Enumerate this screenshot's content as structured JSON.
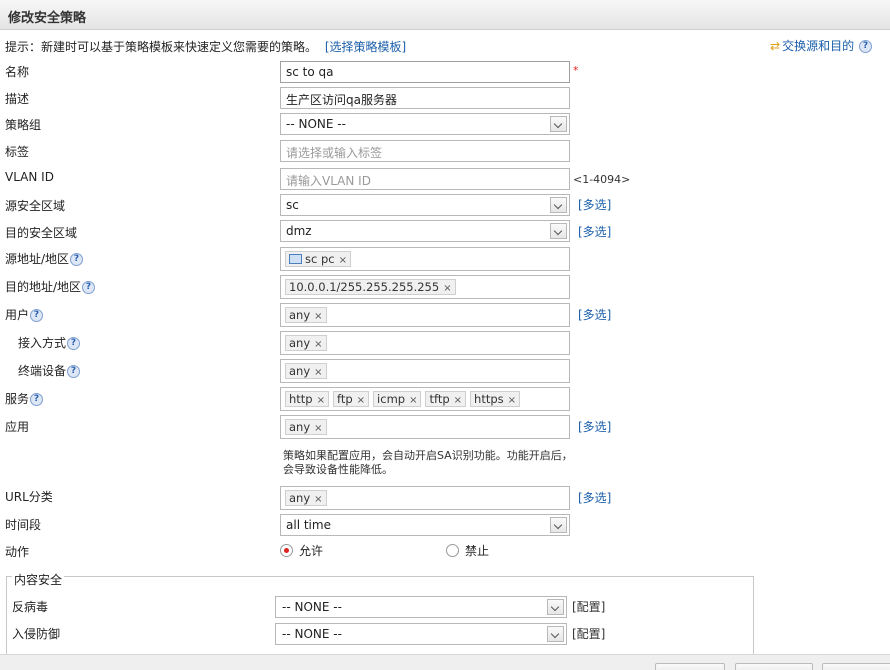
{
  "window": {
    "title": "修改安全策略"
  },
  "tip": {
    "text": "提示：新建时可以基于策略模板来快速定义您需要的策略。",
    "link": "[选择策略模板]"
  },
  "swap_link": "交换源和目的",
  "help_glyph": "?",
  "required_mark": "*",
  "multi_select": "[多选]",
  "vlan_hint": "<1-4094>",
  "config_link": "[配置]",
  "form": {
    "name": {
      "label": "名称",
      "value": "sc to qa"
    },
    "desc": {
      "label": "描述",
      "value": "生产区访问qa服务器"
    },
    "group": {
      "label": "策略组",
      "value": "-- NONE --"
    },
    "tag": {
      "label": "标签",
      "placeholder": "请选择或输入标签"
    },
    "vlan": {
      "label": "VLAN ID",
      "placeholder": "请输入VLAN ID"
    },
    "src_zone": {
      "label": "源安全区域",
      "value": "sc"
    },
    "dst_zone": {
      "label": "目的安全区域",
      "value": "dmz"
    },
    "src_addr": {
      "label": "源地址/地区",
      "tags": [
        "sc pc"
      ]
    },
    "dst_addr": {
      "label": "目的地址/地区",
      "tags": [
        "10.0.0.1/255.255.255.255"
      ]
    },
    "user": {
      "label": "用户",
      "tags": [
        "any"
      ]
    },
    "access": {
      "label": "接入方式",
      "tags": [
        "any"
      ]
    },
    "terminal": {
      "label": "终端设备",
      "tags": [
        "any"
      ]
    },
    "service": {
      "label": "服务",
      "tags": [
        "http",
        "ftp",
        "icmp",
        "tftp",
        "https"
      ]
    },
    "app": {
      "label": "应用",
      "tags": [
        "any"
      ]
    },
    "app_note": "策略如果配置应用，会自动开启SA识别功能。功能开启后，会导致设备性能降低。",
    "url": {
      "label": "URL分类",
      "tags": [
        "any"
      ]
    },
    "time": {
      "label": "时间段",
      "value": "all time"
    },
    "action": {
      "label": "动作",
      "allow": "允许",
      "deny": "禁止",
      "selected": "allow"
    }
  },
  "content_security": {
    "legend": "内容安全",
    "antivirus": {
      "label": "反病毒",
      "value": "-- NONE --"
    },
    "ips": {
      "label": "入侵防御",
      "value": "-- NONE --"
    }
  },
  "tag_remove": "×"
}
